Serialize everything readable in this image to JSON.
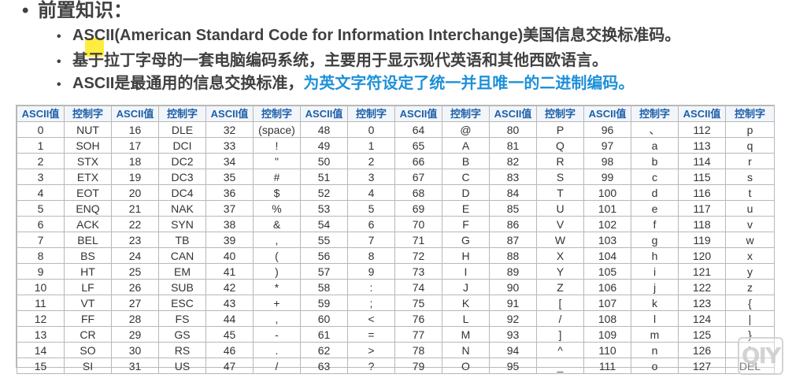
{
  "slide": {
    "title_bullet": "•",
    "title": "前置知识：",
    "bullets": [
      {
        "marker": "•",
        "text": "ASCII(American Standard Code for Information Interchange)美国信息交换标准码。"
      },
      {
        "marker": "•",
        "text": "基于拉丁字母的一套电脑编码系统，主要用于显示现代英语和其他西欧语言。"
      },
      {
        "marker": "•",
        "text": "ASCII是最通用的信息交换标准，",
        "highlight": "为英文字符设定了统一并且唯一的二进制编码。"
      }
    ]
  },
  "table": {
    "headers": [
      "ASCII值",
      "控制字",
      "ASCII值",
      "控制字",
      "ASCII值",
      "控制字",
      "ASCII值",
      "控制字",
      "ASCII值",
      "控制字",
      "ASCII值",
      "控制字",
      "ASCII值",
      "控制字",
      "ASCII值",
      "控制字"
    ],
    "rows": [
      [
        "0",
        "NUT",
        "16",
        "DLE",
        "32",
        "(space)",
        "48",
        "0",
        "64",
        "@",
        "80",
        "P",
        "96",
        "、",
        "112",
        "p"
      ],
      [
        "1",
        "SOH",
        "17",
        "DCI",
        "33",
        "!",
        "49",
        "1",
        "65",
        "A",
        "81",
        "Q",
        "97",
        "a",
        "113",
        "q"
      ],
      [
        "2",
        "STX",
        "18",
        "DC2",
        "34",
        "\"",
        "50",
        "2",
        "66",
        "B",
        "82",
        "R",
        "98",
        "b",
        "114",
        "r"
      ],
      [
        "3",
        "ETX",
        "19",
        "DC3",
        "35",
        "#",
        "51",
        "3",
        "67",
        "C",
        "83",
        "S",
        "99",
        "c",
        "115",
        "s"
      ],
      [
        "4",
        "EOT",
        "20",
        "DC4",
        "36",
        "$",
        "52",
        "4",
        "68",
        "D",
        "84",
        "T",
        "100",
        "d",
        "116",
        "t"
      ],
      [
        "5",
        "ENQ",
        "21",
        "NAK",
        "37",
        "%",
        "53",
        "5",
        "69",
        "E",
        "85",
        "U",
        "101",
        "e",
        "117",
        "u"
      ],
      [
        "6",
        "ACK",
        "22",
        "SYN",
        "38",
        "&",
        "54",
        "6",
        "70",
        "F",
        "86",
        "V",
        "102",
        "f",
        "118",
        "v"
      ],
      [
        "7",
        "BEL",
        "23",
        "TB",
        "39",
        ",",
        "55",
        "7",
        "71",
        "G",
        "87",
        "W",
        "103",
        "g",
        "119",
        "w"
      ],
      [
        "8",
        "BS",
        "24",
        "CAN",
        "40",
        "(",
        "56",
        "8",
        "72",
        "H",
        "88",
        "X",
        "104",
        "h",
        "120",
        "x"
      ],
      [
        "9",
        "HT",
        "25",
        "EM",
        "41",
        ")",
        "57",
        "9",
        "73",
        "I",
        "89",
        "Y",
        "105",
        "i",
        "121",
        "y"
      ],
      [
        "10",
        "LF",
        "26",
        "SUB",
        "42",
        "*",
        "58",
        ":",
        "74",
        "J",
        "90",
        "Z",
        "106",
        "j",
        "122",
        "z"
      ],
      [
        "11",
        "VT",
        "27",
        "ESC",
        "43",
        "+",
        "59",
        ";",
        "75",
        "K",
        "91",
        "[",
        "107",
        "k",
        "123",
        "{"
      ],
      [
        "12",
        "FF",
        "28",
        "FS",
        "44",
        ",",
        "60",
        "<",
        "76",
        "L",
        "92",
        "/",
        "108",
        "l",
        "124",
        "|"
      ],
      [
        "13",
        "CR",
        "29",
        "GS",
        "45",
        "-",
        "61",
        "=",
        "77",
        "M",
        "93",
        "]",
        "109",
        "m",
        "125",
        "}"
      ],
      [
        "14",
        "SO",
        "30",
        "RS",
        "46",
        ".",
        "62",
        ">",
        "78",
        "N",
        "94",
        "^",
        "110",
        "n",
        "126",
        "`"
      ],
      [
        "15",
        "SI",
        "31",
        "US",
        "47",
        "/",
        "63",
        "?",
        "79",
        "O",
        "95",
        "_",
        "111",
        "o",
        "127",
        "DEL"
      ]
    ]
  },
  "watermark": {
    "text": "QIY",
    "icon": "iqiyi-logo-icon"
  },
  "colors": {
    "text": "#404040",
    "highlight": "#1e90d8",
    "header_text": "#1d5fa8",
    "header_bg": "#f2f6fb",
    "border": "#b8b8b8",
    "cursor_highlight": "#ffe600"
  }
}
